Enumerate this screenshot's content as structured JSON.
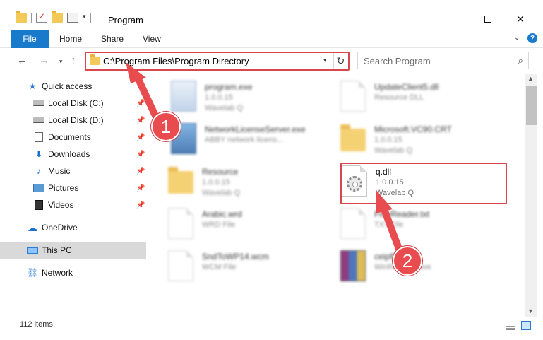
{
  "window": {
    "title": "Program",
    "minimize_glyph": "—",
    "close_glyph": "✕"
  },
  "ribbon": {
    "tabs": [
      {
        "label": "File"
      },
      {
        "label": "Home"
      },
      {
        "label": "Share"
      },
      {
        "label": "View"
      }
    ],
    "help_glyph": "?"
  },
  "nav": {
    "back_glyph": "←",
    "forward_glyph": "→",
    "recent_glyph": "▾",
    "up_glyph": "↑",
    "address": "C:\\Program Files\\Program Directory",
    "address_dropdown_glyph": "▾",
    "refresh_glyph": "↻",
    "search_placeholder": "Search Program",
    "search_glyph": "⌕"
  },
  "sidebar": {
    "items": [
      {
        "label": "Quick access",
        "icon": "star-icon"
      },
      {
        "label": "Local Disk (C:)",
        "icon": "drive-icon",
        "pinned": true
      },
      {
        "label": "Local Disk (D:)",
        "icon": "drive-icon",
        "pinned": true
      },
      {
        "label": "Documents",
        "icon": "documents-icon",
        "pinned": true
      },
      {
        "label": "Downloads",
        "icon": "downloads-icon",
        "pinned": true
      },
      {
        "label": "Music",
        "icon": "music-icon",
        "pinned": true
      },
      {
        "label": "Pictures",
        "icon": "pictures-icon",
        "pinned": true
      },
      {
        "label": "Videos",
        "icon": "videos-icon",
        "pinned": true
      },
      {
        "label": "OneDrive",
        "icon": "onedrive-icon"
      },
      {
        "label": "This PC",
        "icon": "this-pc-icon",
        "selected": true
      },
      {
        "label": "Network",
        "icon": "network-icon"
      }
    ],
    "pin_glyph": "📌"
  },
  "files": [
    {
      "name": "program.exe",
      "line1": "1.0.0.15",
      "line2": "Wavelab Q",
      "icon": "exe-icon"
    },
    {
      "name": "UpdateClient5.dll",
      "line1": "Resource DLL",
      "line2": "",
      "icon": "dll-icon"
    },
    {
      "name": "NetworkLicenseServer.exe",
      "line1": "ABBY network licens...",
      "line2": "",
      "icon": "exe-icon"
    },
    {
      "name": "Microsoft.VC90.CRT",
      "line1": "1.0.0.15",
      "line2": "Wavelab Q",
      "icon": "folder-icon"
    },
    {
      "name": "Resource",
      "line1": "1.0.0.15",
      "line2": "Wavelab Q",
      "icon": "folder-icon"
    },
    {
      "name": "q.dll",
      "line1": "1.0.0.15",
      "line2": "Wavelab Q",
      "icon": "dll-icon"
    },
    {
      "name": "Arabic.wrd",
      "line1": "WRD File",
      "line2": "",
      "icon": "document-icon"
    },
    {
      "name": "FineReader.txt",
      "line1": "TXT File",
      "line2": "",
      "icon": "document-icon"
    },
    {
      "name": "SndToWP14.wcm",
      "line1": "WCM File",
      "line2": "",
      "icon": "document-icon"
    },
    {
      "name": "ceipfiles.cab",
      "line1": "WinRAR archive",
      "line2": "",
      "icon": "archive-icon"
    }
  ],
  "status": {
    "item_count": "112 items"
  },
  "annotations": {
    "step1": "1",
    "step2": "2",
    "color": "#e84c4f"
  },
  "colors": {
    "accent": "#1979ca",
    "highlight_border": "#d9474c",
    "selected_bg": "#d9d9d9"
  }
}
